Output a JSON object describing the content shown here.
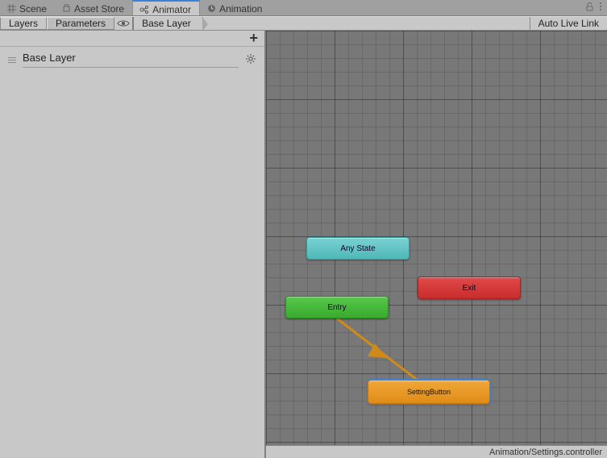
{
  "windowTabs": {
    "scene": "Scene",
    "assetStore": "Asset Store",
    "animator": "Animator",
    "animation": "Animation"
  },
  "toolbar": {
    "layers": "Layers",
    "parameters": "Parameters",
    "breadcrumb": "Base Layer",
    "autoLiveLink": "Auto Live Link"
  },
  "layersPanel": {
    "items": [
      {
        "name": "Base Layer"
      }
    ]
  },
  "graph": {
    "nodes": {
      "anyState": "Any State",
      "entry": "Entry",
      "exit": "Exit",
      "settingButton": "SettingButton"
    }
  },
  "footerPath": "Animation/Settings.controller"
}
